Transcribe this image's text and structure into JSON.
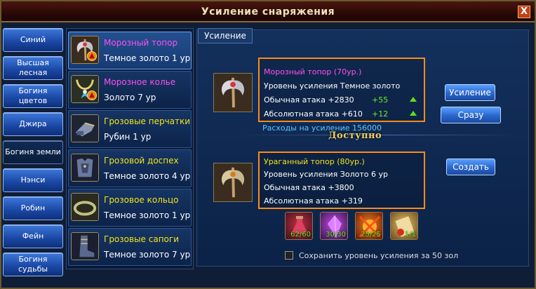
{
  "window": {
    "title": "Усиление снаряжения",
    "close_label": "X"
  },
  "heroes": [
    {
      "label": "Синий",
      "active": false
    },
    {
      "label": "Высшая лесная",
      "active": false
    },
    {
      "label": "Богиня цветов",
      "active": false
    },
    {
      "label": "Джира",
      "active": false
    },
    {
      "label": "Богиня земли",
      "active": true
    },
    {
      "label": "Нэнси",
      "active": false
    },
    {
      "label": "Робин",
      "active": false
    },
    {
      "label": "Фейн",
      "active": false
    },
    {
      "label": "Богиня судьбы",
      "active": false
    }
  ],
  "equipment": [
    {
      "name": "Морозный топор",
      "grade": "Темное золото 1 ур",
      "color": "#ff4ff0",
      "icon": "axe-icon",
      "upgradable": true
    },
    {
      "name": "Морозное колье",
      "grade": "Золото 7 ур",
      "color": "#ff4ff0",
      "icon": "necklace-icon",
      "upgradable": true
    },
    {
      "name": "Грозовые перчатки",
      "grade": "Рубин 1 ур",
      "color": "#f2e21a",
      "icon": "gloves-icon",
      "upgradable": false
    },
    {
      "name": "Грозовой доспех",
      "grade": "Темное золото 4 ур",
      "color": "#f2e21a",
      "icon": "armor-icon",
      "upgradable": false
    },
    {
      "name": "Грозовое кольцо",
      "grade": "Темное золото 1 ур",
      "color": "#f2e21a",
      "icon": "ring-icon",
      "upgradable": false
    },
    {
      "name": "Грозовые сапоги",
      "grade": "Темное золото 7 ур",
      "color": "#f2e21a",
      "icon": "boots-icon",
      "upgradable": false
    }
  ],
  "tab": {
    "label": "Усиление"
  },
  "current": {
    "title": "Морозный топор (70ур.)",
    "level": "Уровень усиления Темное золото",
    "attack": "Обычная атака +2830",
    "attack_bonus": "+55",
    "abs_attack": "Абсолютная атака +610",
    "abs_bonus": "+12"
  },
  "actions": {
    "upgrade_label": "Усиление",
    "instant_label": "Сразу",
    "create_label": "Создать"
  },
  "cost": "Расходы на усиление 156000",
  "available": "Доступно",
  "next": {
    "title": "Ураганный топор (80ур.)",
    "level": "Уровень усиления Золото 6 ур",
    "attack": "Обычная атака +3800",
    "abs_attack": "Абсолютная атака +319"
  },
  "materials": [
    {
      "count": "62/60",
      "icon": "potion-icon"
    },
    {
      "count": "30/30",
      "icon": "crystal-icon"
    },
    {
      "count": "25/25",
      "icon": "fire-orb-icon"
    },
    {
      "count": "1/1",
      "icon": "scroll-icon"
    }
  ],
  "keep_level": {
    "label": "Сохранить уровень усиления за 50 зол",
    "checked": false
  }
}
